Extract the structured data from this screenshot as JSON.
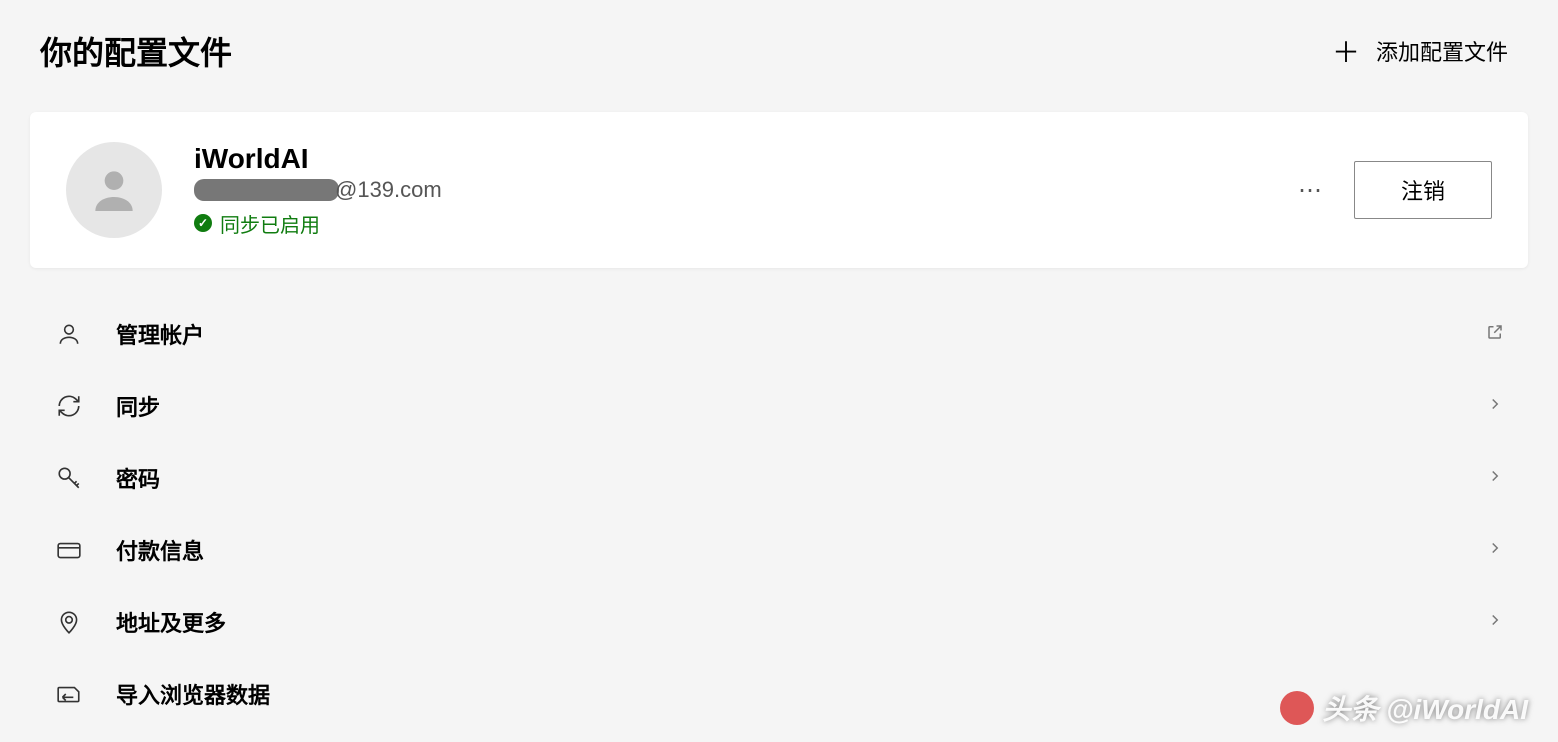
{
  "header": {
    "title": "你的配置文件",
    "add_profile_label": "添加配置文件"
  },
  "profile": {
    "name": "iWorldAI",
    "email_suffix": "@139.com",
    "sync_status": "同步已启用",
    "logout_label": "注销"
  },
  "settings": {
    "items": [
      {
        "label": "管理帐户",
        "icon": "person",
        "action": "external"
      },
      {
        "label": "同步",
        "icon": "sync",
        "action": "chevron"
      },
      {
        "label": "密码",
        "icon": "key",
        "action": "chevron"
      },
      {
        "label": "付款信息",
        "icon": "card",
        "action": "chevron"
      },
      {
        "label": "地址及更多",
        "icon": "location",
        "action": "chevron"
      },
      {
        "label": "导入浏览器数据",
        "icon": "import",
        "action": "none"
      }
    ]
  },
  "watermark": "头条 @iWorldAI"
}
